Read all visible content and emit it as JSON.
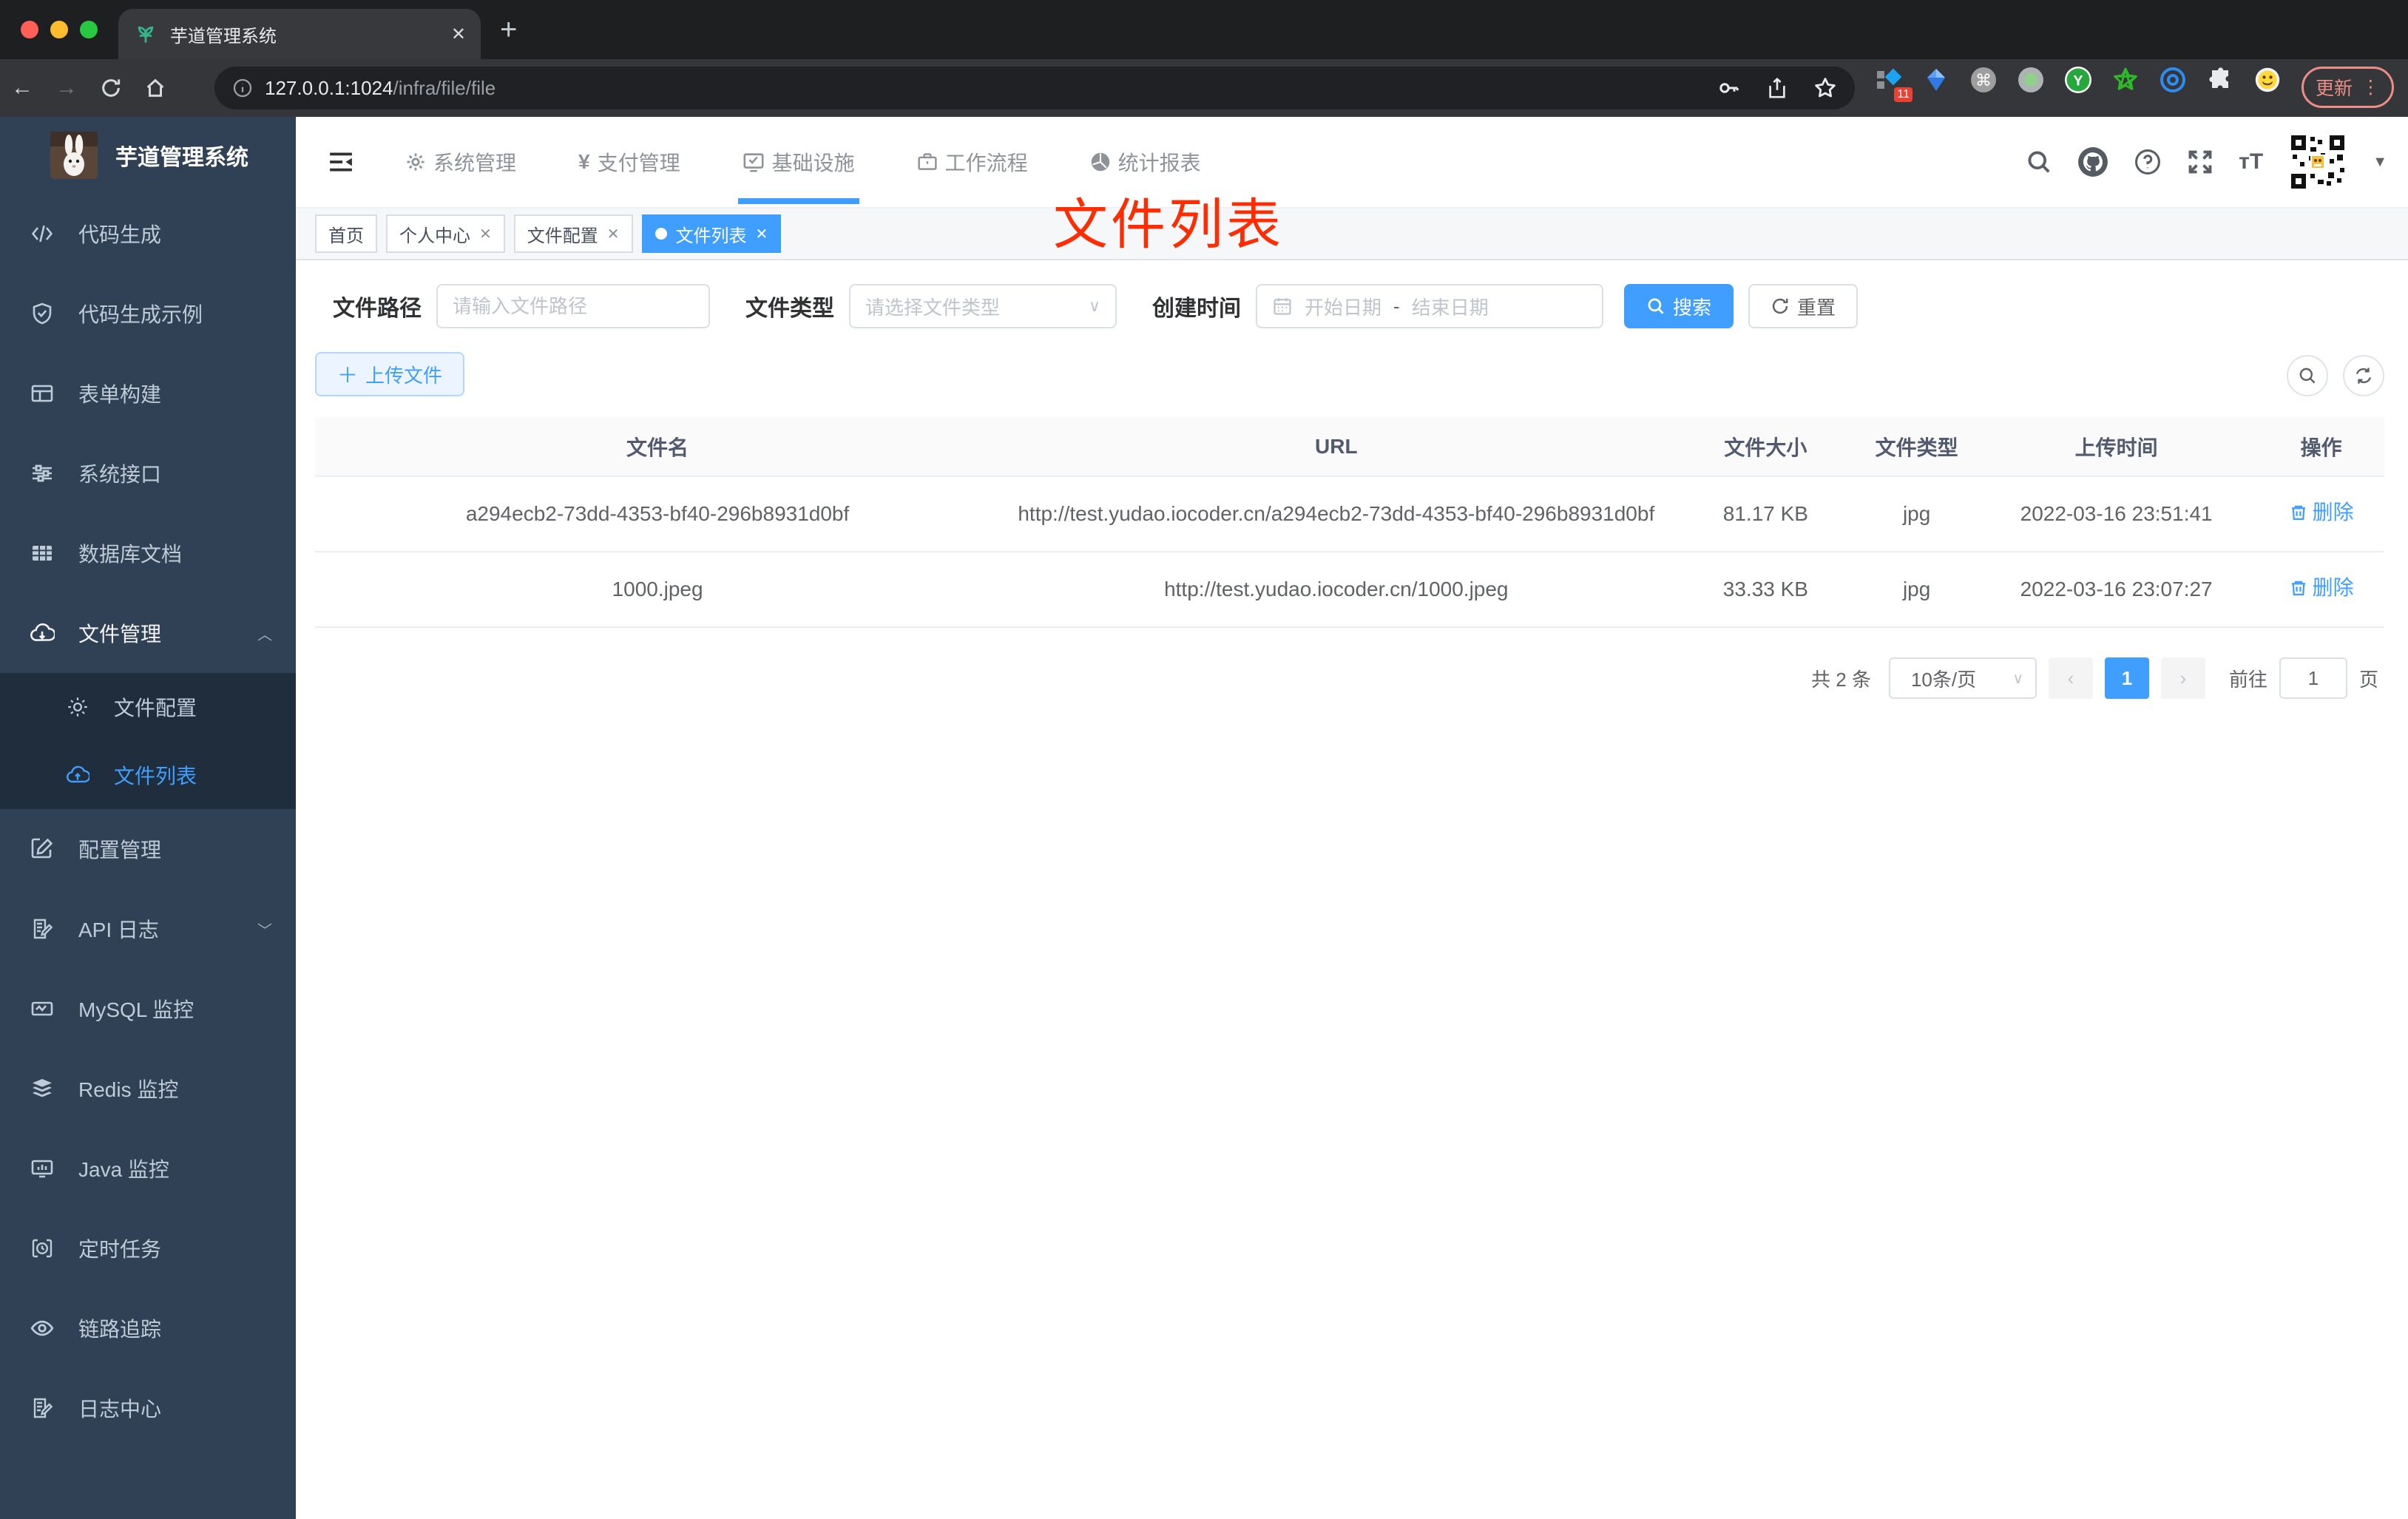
{
  "browser": {
    "tab_title": "芋道管理系统",
    "url_host": "127.0.0.1:1024",
    "url_path": "/infra/file/file",
    "ext_badge": "11",
    "update_label": "更新",
    "new_tab_label": "+"
  },
  "app": {
    "logo_title": "芋道管理系统",
    "nav_items": [
      "系统管理",
      "支付管理",
      "基础设施",
      "工作流程",
      "统计报表"
    ],
    "sidebar_items": [
      "代码生成",
      "代码生成示例",
      "表单构建",
      "系统接口",
      "数据库文档",
      "文件管理",
      "文件配置",
      "文件列表",
      "配置管理",
      "API 日志",
      "MySQL 监控",
      "Redis 监控",
      "Java 监控",
      "定时任务",
      "链路追踪",
      "日志中心"
    ],
    "tags": [
      "首页",
      "个人中心",
      "文件配置",
      "文件列表"
    ],
    "annotation": "文件列表",
    "filters": {
      "path_label": "文件路径",
      "path_placeholder": "请输入文件路径",
      "type_label": "文件类型",
      "type_placeholder": "请选择文件类型",
      "time_label": "创建时间",
      "start_placeholder": "开始日期",
      "range_separator": "-",
      "end_placeholder": "结束日期",
      "search_label": "搜索",
      "reset_label": "重置"
    },
    "toolbar": {
      "upload_label": "上传文件"
    },
    "table": {
      "columns": [
        "文件名",
        "URL",
        "文件大小",
        "文件类型",
        "上传时间",
        "操作"
      ],
      "rows": [
        {
          "name": "a294ecb2-73dd-4353-bf40-296b8931d0bf",
          "url": "http://test.yudao.iocoder.cn/a294ecb2-73dd-4353-bf40-296b8931d0bf",
          "size": "81.17 KB",
          "type": "jpg",
          "time": "2022-03-16 23:51:41",
          "action": "删除"
        },
        {
          "name": "1000.jpeg",
          "url": "http://test.yudao.iocoder.cn/1000.jpeg",
          "size": "33.33 KB",
          "type": "jpg",
          "time": "2022-03-16 23:07:27",
          "action": "删除"
        }
      ]
    },
    "pagination": {
      "total_text": "共 2 条",
      "page_size": "10条/页",
      "current_page": "1",
      "goto_label": "前往",
      "goto_value": "1",
      "page_unit": "页"
    }
  },
  "colors": {
    "accent": "#409eff",
    "annotation_red": "#fe2c02",
    "sidebar_bg": "#304156",
    "submenu_bg": "#1f2d3d",
    "tag_active": "#409eff"
  }
}
